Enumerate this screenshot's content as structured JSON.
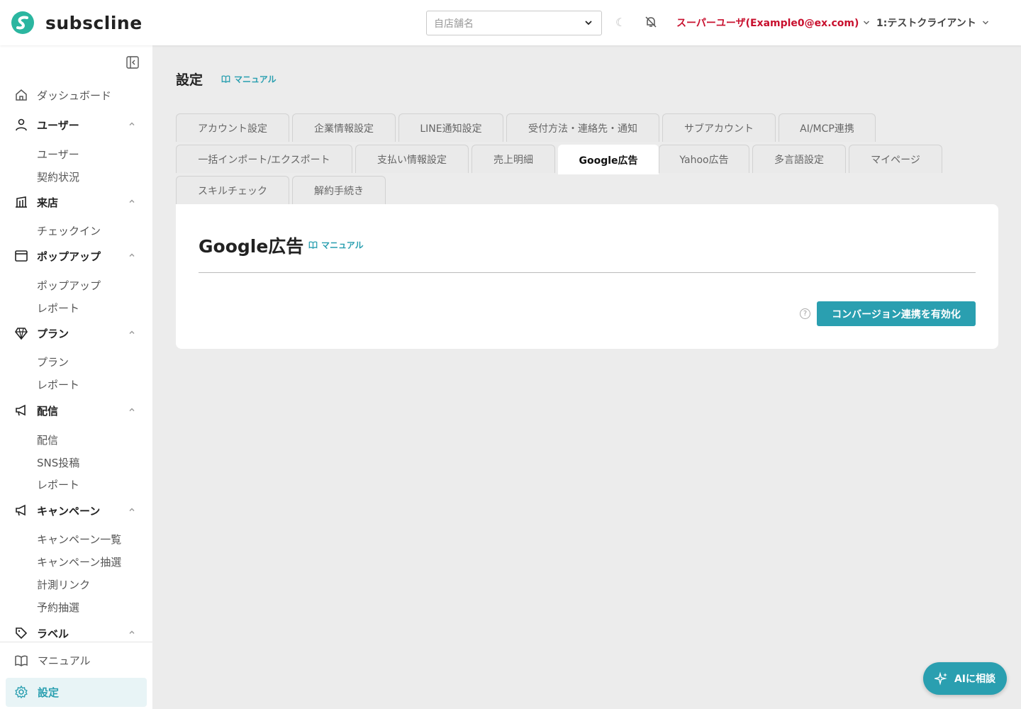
{
  "header": {
    "logo_text": "subscline",
    "store_placeholder": "自店舗名",
    "user_label": "スーパーユーザ(Example0@ex.com)",
    "client_label": "1:テストクライアント",
    "moon_glyph": "☾"
  },
  "sidebar": {
    "items": [
      {
        "label": "ダッシュボード",
        "icon": "home-icon"
      },
      {
        "label": "ユーザー",
        "icon": "user-icon",
        "subs": [
          "ユーザー",
          "契約状況"
        ]
      },
      {
        "label": "来店",
        "icon": "building-icon",
        "subs": [
          "チェックイン"
        ]
      },
      {
        "label": "ポップアップ",
        "icon": "window-icon",
        "subs": [
          "ポップアップ",
          "レポート"
        ]
      },
      {
        "label": "プラン",
        "icon": "diamond-icon",
        "subs": [
          "プラン",
          "レポート"
        ]
      },
      {
        "label": "配信",
        "icon": "megaphone-icon",
        "subs": [
          "配信",
          "SNS投稿",
          "レポート"
        ]
      },
      {
        "label": "キャンペーン",
        "icon": "megaphone-icon",
        "subs": [
          "キャンペーン一覧",
          "キャンペーン抽選",
          "計測リンク",
          "予約抽選"
        ]
      },
      {
        "label": "ラベル",
        "icon": "tag-icon"
      }
    ],
    "manual_label": "マニュアル",
    "settings_label": "設定"
  },
  "page": {
    "title": "設定",
    "manual_label": "マニュアル"
  },
  "tabs": {
    "row1": [
      "アカウント設定",
      "企業情報設定",
      "LINE通知設定",
      "受付方法・連絡先・通知",
      "サブアカウント",
      "AI/MCP連携"
    ],
    "row2": [
      "一括インポート/エクスポート",
      "支払い情報設定",
      "売上明細",
      "Google広告",
      "Yahoo広告",
      "多言語設定",
      "マイページ"
    ],
    "row3": [
      "スキルチェック",
      "解約手続き"
    ],
    "active": "Google広告"
  },
  "panel": {
    "title": "Google広告",
    "manual_label": "マニュアル",
    "help_glyph": "?",
    "enable_button": "コンバージョン連携を有効化"
  },
  "ai_button": {
    "label": "AIに相談"
  },
  "colors": {
    "accent": "#2a9fb0",
    "user_red": "#c8102e",
    "bg": "#ececec"
  }
}
